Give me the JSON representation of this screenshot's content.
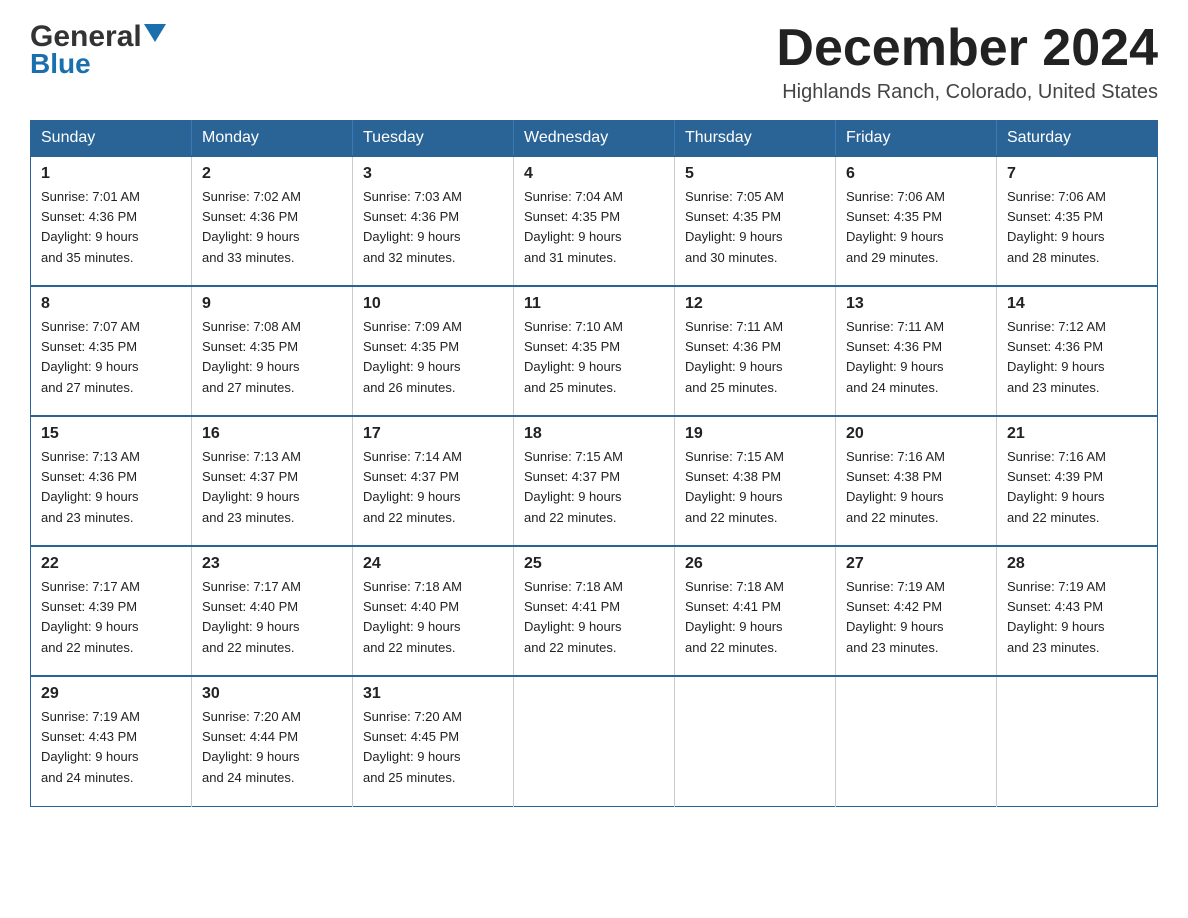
{
  "header": {
    "logo_general": "General",
    "logo_blue": "Blue",
    "month_title": "December 2024",
    "location": "Highlands Ranch, Colorado, United States"
  },
  "weekdays": [
    "Sunday",
    "Monday",
    "Tuesday",
    "Wednesday",
    "Thursday",
    "Friday",
    "Saturday"
  ],
  "weeks": [
    [
      {
        "day": "1",
        "sunrise": "7:01 AM",
        "sunset": "4:36 PM",
        "daylight": "9 hours and 35 minutes."
      },
      {
        "day": "2",
        "sunrise": "7:02 AM",
        "sunset": "4:36 PM",
        "daylight": "9 hours and 33 minutes."
      },
      {
        "day": "3",
        "sunrise": "7:03 AM",
        "sunset": "4:36 PM",
        "daylight": "9 hours and 32 minutes."
      },
      {
        "day": "4",
        "sunrise": "7:04 AM",
        "sunset": "4:35 PM",
        "daylight": "9 hours and 31 minutes."
      },
      {
        "day": "5",
        "sunrise": "7:05 AM",
        "sunset": "4:35 PM",
        "daylight": "9 hours and 30 minutes."
      },
      {
        "day": "6",
        "sunrise": "7:06 AM",
        "sunset": "4:35 PM",
        "daylight": "9 hours and 29 minutes."
      },
      {
        "day": "7",
        "sunrise": "7:06 AM",
        "sunset": "4:35 PM",
        "daylight": "9 hours and 28 minutes."
      }
    ],
    [
      {
        "day": "8",
        "sunrise": "7:07 AM",
        "sunset": "4:35 PM",
        "daylight": "9 hours and 27 minutes."
      },
      {
        "day": "9",
        "sunrise": "7:08 AM",
        "sunset": "4:35 PM",
        "daylight": "9 hours and 27 minutes."
      },
      {
        "day": "10",
        "sunrise": "7:09 AM",
        "sunset": "4:35 PM",
        "daylight": "9 hours and 26 minutes."
      },
      {
        "day": "11",
        "sunrise": "7:10 AM",
        "sunset": "4:35 PM",
        "daylight": "9 hours and 25 minutes."
      },
      {
        "day": "12",
        "sunrise": "7:11 AM",
        "sunset": "4:36 PM",
        "daylight": "9 hours and 25 minutes."
      },
      {
        "day": "13",
        "sunrise": "7:11 AM",
        "sunset": "4:36 PM",
        "daylight": "9 hours and 24 minutes."
      },
      {
        "day": "14",
        "sunrise": "7:12 AM",
        "sunset": "4:36 PM",
        "daylight": "9 hours and 23 minutes."
      }
    ],
    [
      {
        "day": "15",
        "sunrise": "7:13 AM",
        "sunset": "4:36 PM",
        "daylight": "9 hours and 23 minutes."
      },
      {
        "day": "16",
        "sunrise": "7:13 AM",
        "sunset": "4:37 PM",
        "daylight": "9 hours and 23 minutes."
      },
      {
        "day": "17",
        "sunrise": "7:14 AM",
        "sunset": "4:37 PM",
        "daylight": "9 hours and 22 minutes."
      },
      {
        "day": "18",
        "sunrise": "7:15 AM",
        "sunset": "4:37 PM",
        "daylight": "9 hours and 22 minutes."
      },
      {
        "day": "19",
        "sunrise": "7:15 AM",
        "sunset": "4:38 PM",
        "daylight": "9 hours and 22 minutes."
      },
      {
        "day": "20",
        "sunrise": "7:16 AM",
        "sunset": "4:38 PM",
        "daylight": "9 hours and 22 minutes."
      },
      {
        "day": "21",
        "sunrise": "7:16 AM",
        "sunset": "4:39 PM",
        "daylight": "9 hours and 22 minutes."
      }
    ],
    [
      {
        "day": "22",
        "sunrise": "7:17 AM",
        "sunset": "4:39 PM",
        "daylight": "9 hours and 22 minutes."
      },
      {
        "day": "23",
        "sunrise": "7:17 AM",
        "sunset": "4:40 PM",
        "daylight": "9 hours and 22 minutes."
      },
      {
        "day": "24",
        "sunrise": "7:18 AM",
        "sunset": "4:40 PM",
        "daylight": "9 hours and 22 minutes."
      },
      {
        "day": "25",
        "sunrise": "7:18 AM",
        "sunset": "4:41 PM",
        "daylight": "9 hours and 22 minutes."
      },
      {
        "day": "26",
        "sunrise": "7:18 AM",
        "sunset": "4:41 PM",
        "daylight": "9 hours and 22 minutes."
      },
      {
        "day": "27",
        "sunrise": "7:19 AM",
        "sunset": "4:42 PM",
        "daylight": "9 hours and 23 minutes."
      },
      {
        "day": "28",
        "sunrise": "7:19 AM",
        "sunset": "4:43 PM",
        "daylight": "9 hours and 23 minutes."
      }
    ],
    [
      {
        "day": "29",
        "sunrise": "7:19 AM",
        "sunset": "4:43 PM",
        "daylight": "9 hours and 24 minutes."
      },
      {
        "day": "30",
        "sunrise": "7:20 AM",
        "sunset": "4:44 PM",
        "daylight": "9 hours and 24 minutes."
      },
      {
        "day": "31",
        "sunrise": "7:20 AM",
        "sunset": "4:45 PM",
        "daylight": "9 hours and 25 minutes."
      },
      null,
      null,
      null,
      null
    ]
  ],
  "labels": {
    "sunrise_prefix": "Sunrise: ",
    "sunset_prefix": "Sunset: ",
    "daylight_prefix": "Daylight: "
  }
}
